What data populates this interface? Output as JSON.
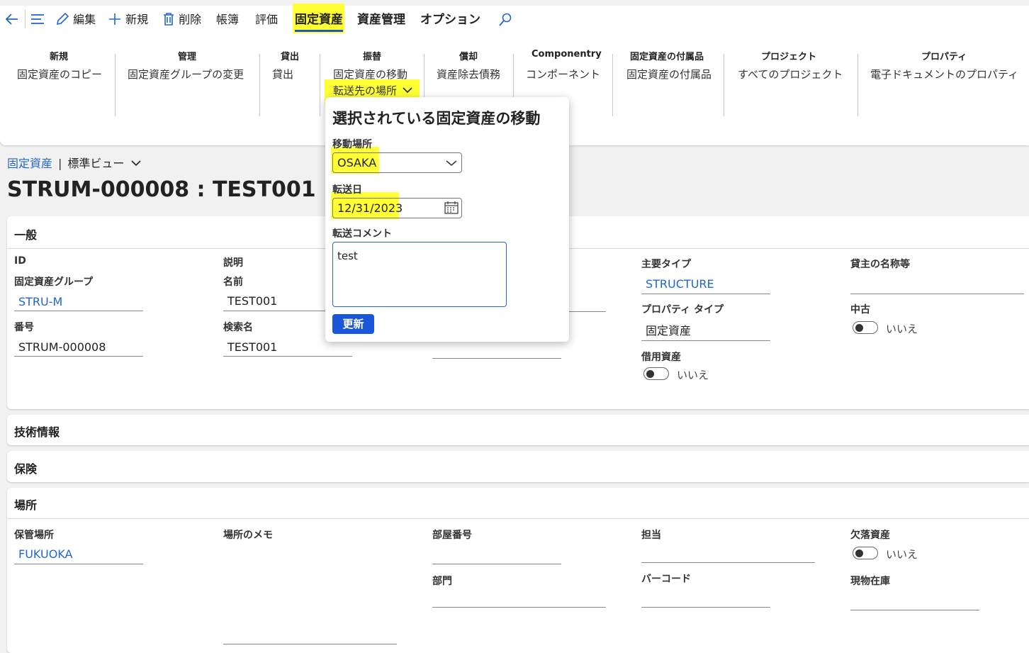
{
  "toolbar": {
    "edit": "編集",
    "new": "新規",
    "delete": "削除",
    "ledger": "帳簿",
    "evaluation": "評価",
    "fixed_assets_tab": "固定資産",
    "asset_mgmt_tab": "資産管理",
    "options_tab": "オプション"
  },
  "ribbon": {
    "groups": [
      {
        "title": "新規",
        "item": "固定資産のコピー"
      },
      {
        "title": "管理",
        "item": "固定資産グループの変更"
      },
      {
        "title": "貸出",
        "item": "貸出"
      },
      {
        "title": "振替",
        "item": "固定資産の移動",
        "dropdown": "転送先の場所"
      },
      {
        "title": "償却",
        "item": "資産除去債務"
      },
      {
        "title": "Componentry",
        "item": "コンポーネント"
      },
      {
        "title": "固定資産の付属品",
        "item": "固定資産の付属品"
      },
      {
        "title": "プロジェクト",
        "item": "すべてのプロジェクト"
      },
      {
        "title": "プロパティ",
        "item": "電子ドキュメントのプロパティ"
      }
    ]
  },
  "breadcrumb": {
    "module": "固定資産",
    "view": "標準ビュー"
  },
  "page_title": "STRUM-000008 : TEST001",
  "general": {
    "title": "一般",
    "id_header": "ID",
    "asset_group_label": "固定資産グループ",
    "asset_group_value": "STRU-M",
    "number_label": "番号",
    "number_value": "STRUM-000008",
    "description_header": "説明",
    "name_label": "名前",
    "name_value": "TEST001",
    "search_name_label": "検索名",
    "search_name_value": "TEST001",
    "main_type_label": "主要タイプ",
    "main_type_value": "STRUCTURE",
    "property_type_label": "プロパティ タイプ",
    "property_type_value": "固定資産",
    "borrowed_label": "借用資産",
    "borrowed_value": "いいえ",
    "lessor_label": "貸主の名称等",
    "used_label": "中古",
    "used_value": "いいえ"
  },
  "technical": {
    "title": "技術情報"
  },
  "insurance": {
    "title": "保険"
  },
  "location": {
    "title": "場所",
    "storage_label": "保管場所",
    "storage_value": "FUKUOKA",
    "memo_label": "場所のメモ",
    "room_label": "部屋番号",
    "dept_label": "部門",
    "owner_label": "担当",
    "barcode_label": "バーコード",
    "missing_label": "欠落資産",
    "missing_value": "いいえ",
    "physical_inventory_label": "現物在庫"
  },
  "flyout": {
    "title": "選択されている固定資産の移動",
    "location_label": "移動場所",
    "location_value": "OSAKA",
    "date_label": "転送日",
    "date_value": "12/31/2023",
    "comment_label": "転送コメント",
    "comment_value": "test",
    "update_label": "更新"
  },
  "colors": {
    "accent": "#1a56d8",
    "highlight": "#ffff33",
    "link": "#2266cc"
  }
}
